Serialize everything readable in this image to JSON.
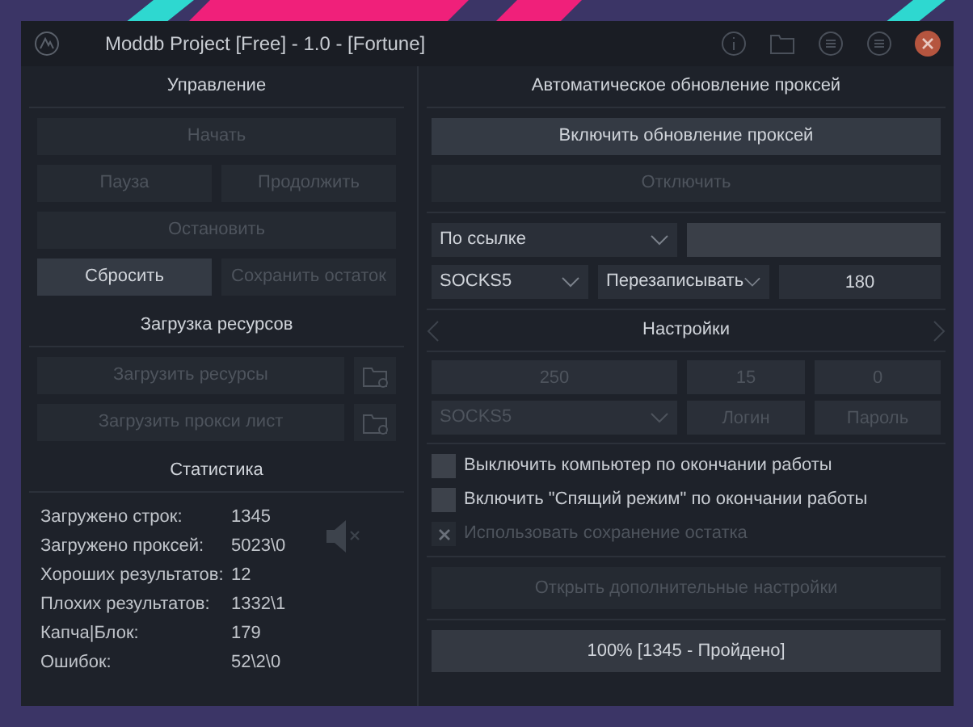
{
  "window": {
    "title": "Moddb Project [Free] - 1.0 - [Fortune]"
  },
  "control": {
    "title": "Управление",
    "rows": [
      [
        {
          "label": "Начать",
          "disabled": true
        }
      ],
      [
        {
          "label": "Пауза",
          "disabled": true
        },
        {
          "label": "Продолжить",
          "disabled": true
        }
      ],
      [
        {
          "label": "Остановить",
          "disabled": true
        }
      ],
      [
        {
          "label": "Сбросить",
          "disabled": false
        },
        {
          "label": "Сохранить остаток",
          "disabled": true
        }
      ]
    ]
  },
  "resources": {
    "title": "Загрузка ресурсов",
    "buttons": [
      {
        "label": "Загрузить ресурсы",
        "disabled": true
      },
      {
        "label": "Загрузить прокси лист",
        "disabled": true
      }
    ]
  },
  "stats": {
    "title": "Статистика",
    "muted": true,
    "rows": [
      {
        "label": "Загружено строк:",
        "value": "1345"
      },
      {
        "label": "Загружено проксей:",
        "value": "5023\\0"
      },
      {
        "label": "Хороших результатов:",
        "value": "12"
      },
      {
        "label": "Плохих результатов:",
        "value": "1332\\1"
      },
      {
        "label": "Капча|Блок:",
        "value": "179"
      },
      {
        "label": "Ошибок:",
        "value": "52\\2\\0"
      }
    ]
  },
  "proxy_update": {
    "title": "Автоматическое обновление проксей",
    "buttons": [
      {
        "label": "Включить обновление проксей",
        "disabled": false
      },
      {
        "label": "Отключить",
        "disabled": true
      }
    ],
    "source_select": {
      "value": "По ссылке"
    },
    "type_select": {
      "value": "SOCKS5"
    },
    "mode_select": {
      "value": "Перезаписывать"
    },
    "interval_field": {
      "value": "180"
    }
  },
  "settings": {
    "title": "Настройки",
    "threads_field": {
      "value": "250",
      "disabled": true
    },
    "timeout_field": {
      "value": "15",
      "disabled": true
    },
    "retries_field": {
      "value": "0",
      "disabled": true
    },
    "proxy_type_select": {
      "value": "SOCKS5",
      "disabled": true
    },
    "login_field": {
      "placeholder": "Логин",
      "disabled": true
    },
    "password_field": {
      "placeholder": "Пароль",
      "disabled": true
    }
  },
  "options": [
    {
      "label": "Выключить компьютер по окончании работы",
      "checked": false,
      "disabled": false
    },
    {
      "label": "Включить \"Спящий режим\" по окончании работы",
      "checked": false,
      "disabled": false
    },
    {
      "label": "Использовать сохранение остатка",
      "checked": true,
      "disabled": true
    }
  ],
  "advanced_button": {
    "label": "Открыть дополнительные настройки",
    "disabled": true
  },
  "progress": {
    "label": "100% [1345 - Пройдено]",
    "level": 1
  }
}
